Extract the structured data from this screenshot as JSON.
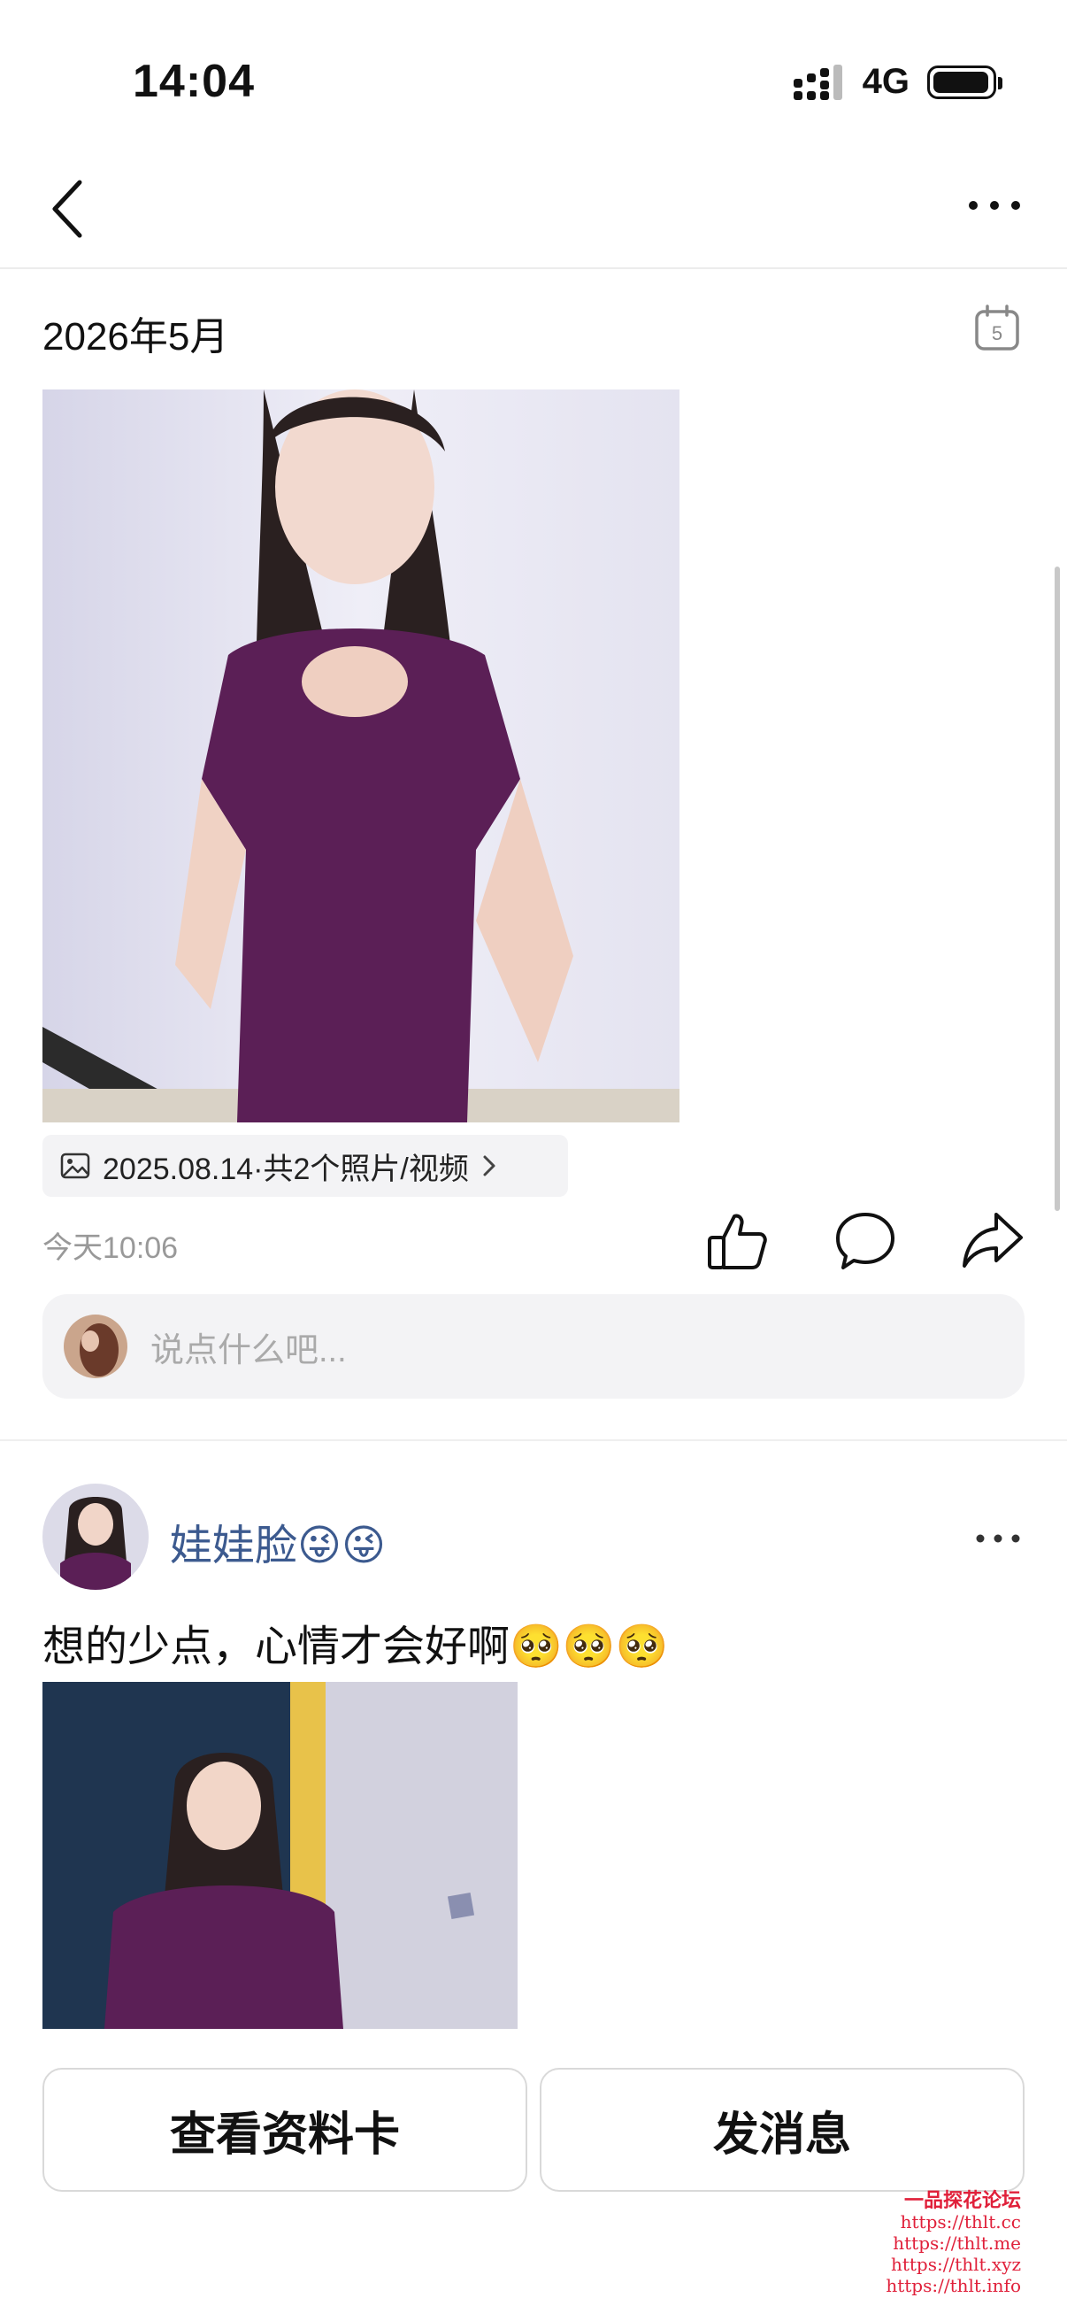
{
  "status_bar": {
    "time": "14:04",
    "network": "4G"
  },
  "header": {
    "back_icon": "chevron-left-icon",
    "more_icon": "ellipsis-icon"
  },
  "section": {
    "month": "2026年5月",
    "calendar_day": "5"
  },
  "post1": {
    "album_label": "2025.08.14·共2个照片/视频",
    "time": "今天10:06",
    "comment_placeholder": "说点什么吧..."
  },
  "post2": {
    "username": "娃娃脸😜😜",
    "text": "想的少点，心情才会好啊🥺🥺🥺"
  },
  "buttons": {
    "profile": "查看资料卡",
    "message": "发消息"
  },
  "watermark": {
    "title": "一品探花论坛",
    "lines": [
      "https://thlt.cc",
      "https://thlt.me",
      "https://thlt.xyz",
      "https://thlt.info"
    ]
  },
  "colors": {
    "username": "#3c5a8f",
    "placeholder": "#aaaaaa",
    "watermark": "#e0203a"
  }
}
